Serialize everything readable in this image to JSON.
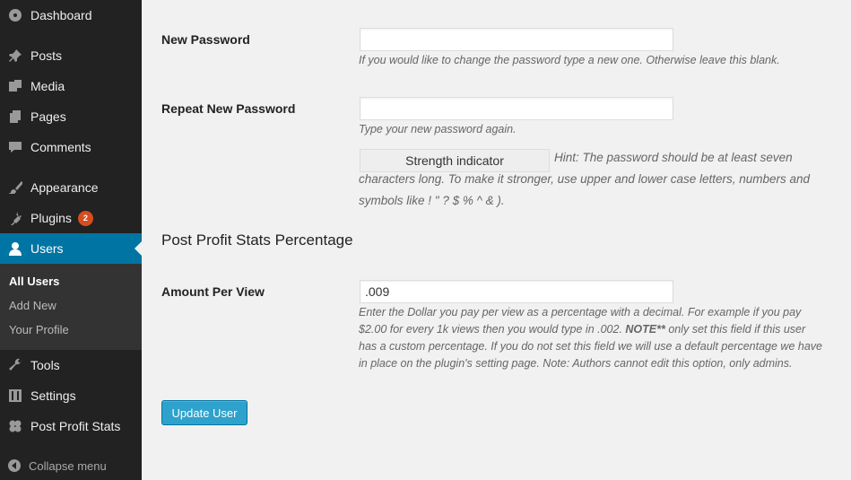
{
  "sidebar": {
    "items": [
      {
        "label": "Dashboard",
        "icon": "dashboard-icon"
      },
      {
        "label": "Posts",
        "icon": "pin-icon"
      },
      {
        "label": "Media",
        "icon": "media-icon"
      },
      {
        "label": "Pages",
        "icon": "pages-icon"
      },
      {
        "label": "Comments",
        "icon": "comment-icon"
      },
      {
        "label": "Appearance",
        "icon": "brush-icon"
      },
      {
        "label": "Plugins",
        "icon": "plugin-icon",
        "badge": "2"
      },
      {
        "label": "Users",
        "icon": "user-icon",
        "active": true
      },
      {
        "label": "Tools",
        "icon": "wrench-icon"
      },
      {
        "label": "Settings",
        "icon": "settings-icon"
      },
      {
        "label": "Post Profit Stats",
        "icon": "flower-icon"
      }
    ],
    "submenu": [
      "All Users",
      "Add New",
      "Your Profile"
    ],
    "collapse_label": "Collapse menu"
  },
  "form": {
    "new_password": {
      "label": "New Password",
      "value": "",
      "description": "If you would like to change the password type a new one. Otherwise leave this blank."
    },
    "repeat_password": {
      "label": "Repeat New Password",
      "value": "",
      "description": "Type your new password again."
    },
    "strength_indicator": "Strength indicator",
    "hint": "Hint: The password should be at least seven characters long. To make it stronger, use upper and lower case letters, numbers and symbols like ! \" ? $ % ^ & ).",
    "section_title": "Post Profit Stats Percentage",
    "amount_per_view": {
      "label": "Amount Per View",
      "value": ".009",
      "description_line1": "Enter the Dollar you pay per view as a percentage with a decimal. For example if you pay",
      "description_line2_a": "$2.00 for every 1k views then you would type in .002. ",
      "description_line2_b": "NOTE**",
      "description_line2_c": " only set this field if this user",
      "description_line3": "has a custom percentage. If you do not set this field we will use a default percentage we have",
      "description_line4": "in place on the plugin's setting page. Note: Authors cannot edit this option, only admins."
    },
    "update_button": "Update User"
  },
  "colors": {
    "sidebar_bg": "#222222",
    "active_bg": "#0074a2",
    "button_bg": "#2ea2cc",
    "badge_bg": "#d54e21",
    "content_bg": "#f1f1f1"
  }
}
